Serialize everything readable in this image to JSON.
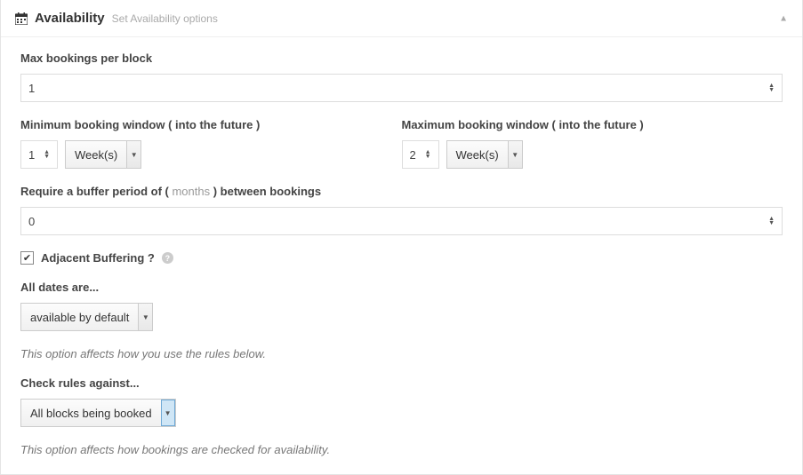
{
  "header": {
    "title": "Availability",
    "subtitle": "Set Availability options"
  },
  "fields": {
    "max_bookings_label": "Max bookings per block",
    "max_bookings_value": "1",
    "min_window_label": "Minimum booking window ( into the future )",
    "min_window_value": "1",
    "min_window_unit": "Week(s)",
    "max_window_label": "Maximum booking window ( into the future )",
    "max_window_value": "2",
    "max_window_unit": "Week(s)",
    "buffer_label_pre": "Require a buffer period of ( ",
    "buffer_label_unit": "months",
    "buffer_label_post": " ) between bookings",
    "buffer_value": "0",
    "adjacent_label": "Adjacent Buffering ?",
    "all_dates_label": "All dates are...",
    "all_dates_value": "available by default",
    "all_dates_help": "This option affects how you use the rules below.",
    "check_rules_label": "Check rules against...",
    "check_rules_value": "All blocks being booked",
    "check_rules_help": "This option affects how bookings are checked for availability."
  }
}
